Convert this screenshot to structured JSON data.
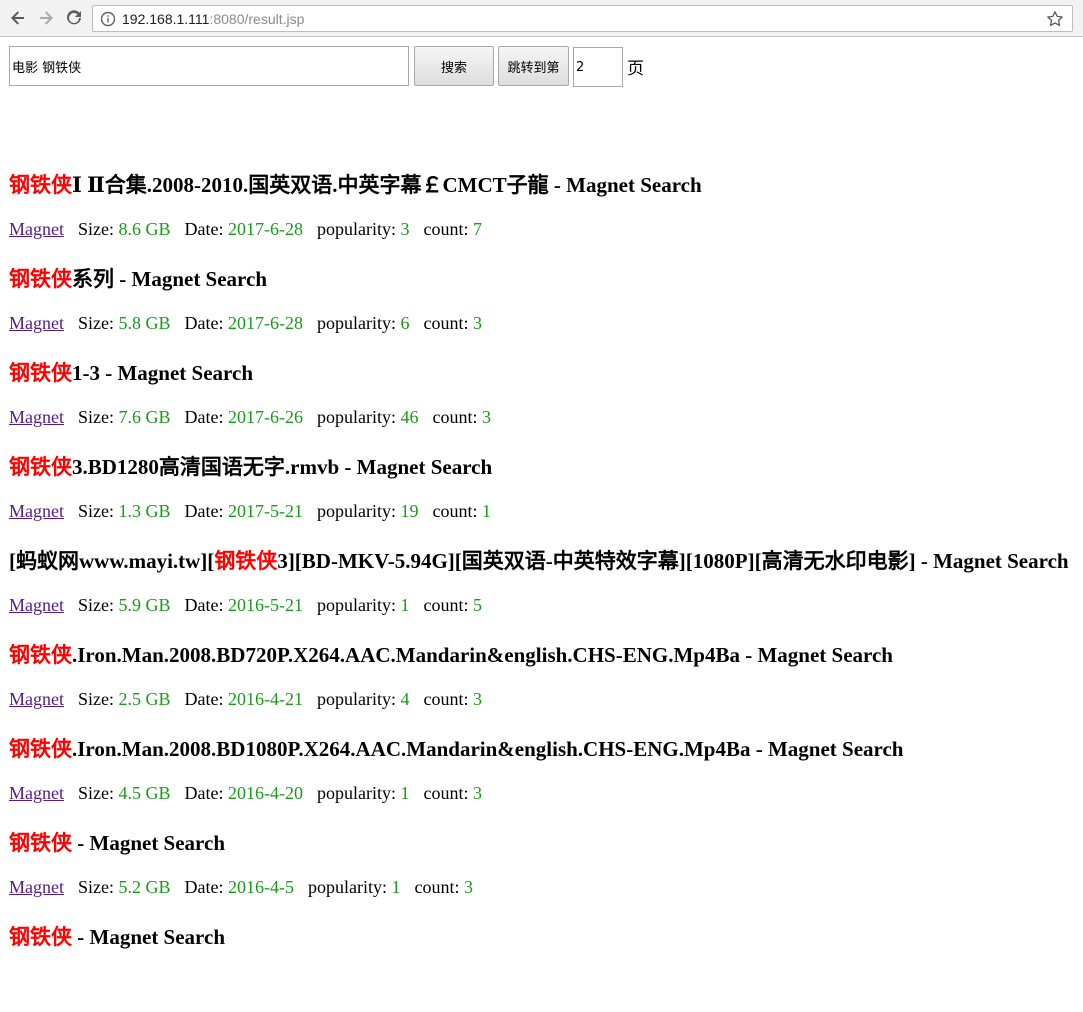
{
  "browser": {
    "url_host": "192.168.1.111",
    "url_rest": ":8080/result.jsp"
  },
  "search": {
    "query": "电影 钢铁侠",
    "search_label": "搜索",
    "jump_label": "跳转到第",
    "page_value": "2",
    "page_suffix": "页"
  },
  "labels": {
    "magnet": "Magnet",
    "size": "Size:",
    "date": "Date:",
    "popularity": "popularity:",
    "count": "count:"
  },
  "results": [
    {
      "pre": "",
      "hl": "钢铁侠",
      "post": "Ⅰ Ⅱ合集.2008-2010.国英双语.中英字幕￡CMCT子龍 - Magnet Search",
      "size": "8.6 GB",
      "date": "2017-6-28",
      "popularity": "3",
      "count": "7"
    },
    {
      "pre": "",
      "hl": "钢铁侠",
      "post": "系列 - Magnet Search",
      "size": "5.8 GB",
      "date": "2017-6-28",
      "popularity": "6",
      "count": "3"
    },
    {
      "pre": "",
      "hl": "钢铁侠",
      "post": "1-3 - Magnet Search",
      "size": "7.6 GB",
      "date": "2017-6-26",
      "popularity": "46",
      "count": "3"
    },
    {
      "pre": "",
      "hl": "钢铁侠",
      "post": "3.BD1280高清国语无字.rmvb - Magnet Search",
      "size": "1.3 GB",
      "date": "2017-5-21",
      "popularity": "19",
      "count": "1"
    },
    {
      "pre": "[蚂蚁网www.mayi.tw][",
      "hl": "钢铁侠",
      "post": "3][BD-MKV-5.94G][国英双语-中英特效字幕][1080P][高清无水印电影] - Magnet Search",
      "size": "5.9 GB",
      "date": "2016-5-21",
      "popularity": "1",
      "count": "5"
    },
    {
      "pre": "",
      "hl": "钢铁侠",
      "post": ".Iron.Man.2008.BD720P.X264.AAC.Mandarin&english.CHS-ENG.Mp4Ba - Magnet Search",
      "size": "2.5 GB",
      "date": "2016-4-21",
      "popularity": "4",
      "count": "3"
    },
    {
      "pre": "",
      "hl": "钢铁侠",
      "post": ".Iron.Man.2008.BD1080P.X264.AAC.Mandarin&english.CHS-ENG.Mp4Ba - Magnet Search",
      "size": "4.5 GB",
      "date": "2016-4-20",
      "popularity": "1",
      "count": "3"
    },
    {
      "pre": "",
      "hl": "钢铁侠",
      "post": " - Magnet Search",
      "size": "5.2 GB",
      "date": "2016-4-5",
      "popularity": "1",
      "count": "3"
    },
    {
      "pre": "",
      "hl": "钢铁侠",
      "post": " - Magnet Search",
      "size": "",
      "date": "",
      "popularity": "",
      "count": ""
    }
  ]
}
